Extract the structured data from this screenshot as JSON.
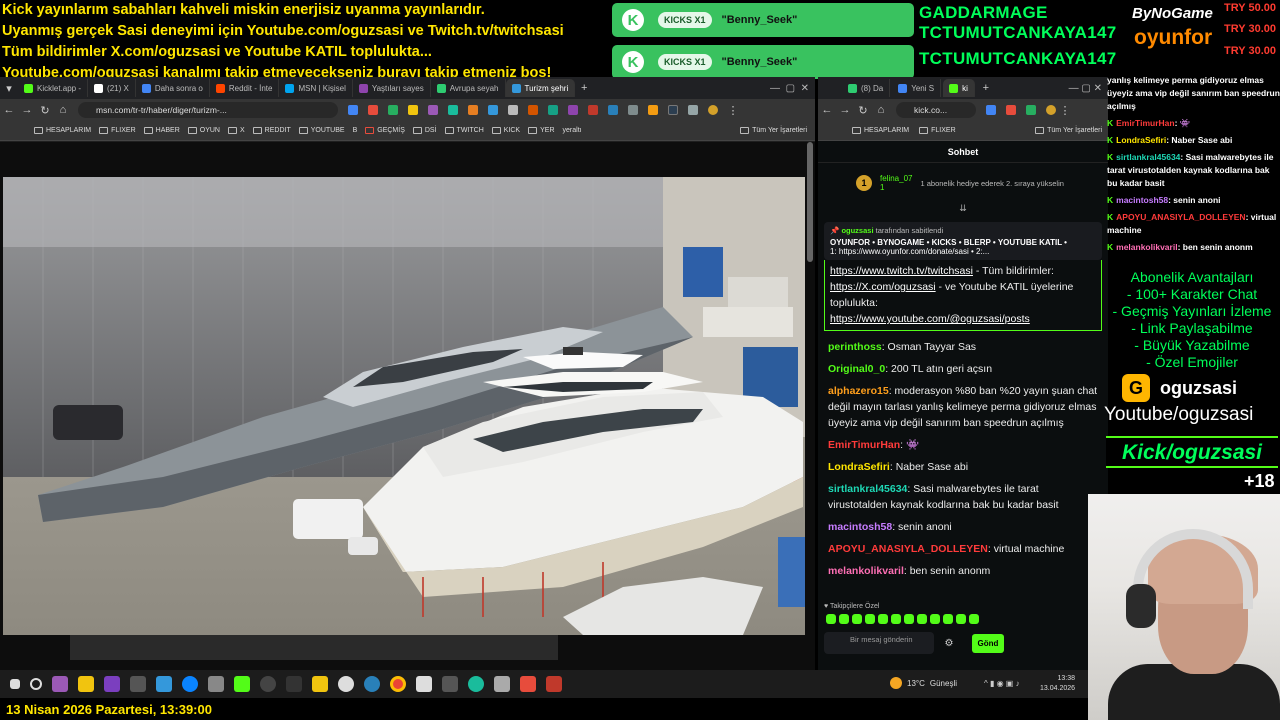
{
  "ticker": [
    "Kick yayınlarım sabahları kahveli miskin enerjisiz uyanma yayınlarıdır.",
    "Uyanmış gerçek Sasi deneyimi için Youtube.com/oguzsasi ve Twitch.tv/twitchsasi",
    "Tüm bildirimler X.com/oguzsasi ve Youtube KATIL toplulukta...",
    "Youtube.com/oguzsasi kanalımı takip etmeyecekseniz burayı takip etmeniz boş!"
  ],
  "notifications": [
    {
      "badge": "KICKS X1",
      "name": "\"Benny_Seek\""
    },
    {
      "badge": "KICKS X1",
      "name": "\"Benny_Seek\""
    }
  ],
  "top_names": [
    "GADDARMAGE",
    "TCTUMUTCANKAYA147",
    "TCTUMUTCANKAYA147"
  ],
  "sponsors": {
    "bynogame": "ByNoGame",
    "oyunfor": "oyunfor"
  },
  "try_values": [
    "TRY 50.00",
    "TRY 30.00",
    "TRY 30.00"
  ],
  "browser1": {
    "tabs": [
      {
        "label": "Kicklet.app -",
        "color": "#53fc18"
      },
      {
        "label": "(21) X",
        "color": "#ffffff"
      },
      {
        "label": "Daha sonra o",
        "color": "#4285f4"
      },
      {
        "label": "Reddit - İnte",
        "color": "#ff4500"
      },
      {
        "label": "MSN | Kişisel",
        "color": "#00a4ef"
      },
      {
        "label": "Yaştıları sayes",
        "color": "#8e44ad"
      },
      {
        "label": "Avrupa seyah",
        "color": "#2ecc71"
      },
      {
        "label": "Turizm şehri",
        "color": "#3498db"
      }
    ],
    "address": "msn.com/tr-tr/haber/diger/turizm-...",
    "bookmarks": [
      "HESAPLARIM",
      "FLIXER",
      "HABER",
      "OYUN",
      "X",
      "REDDIT",
      "YOUTUBE",
      "B",
      "GEÇMİŞ",
      "DSİ",
      "TWITCH",
      "KICK",
      "YER",
      "yeraltı"
    ],
    "bookmarks_right": "Tüm Yer İşaretleri"
  },
  "browser2": {
    "tabs": [
      "(8) Da",
      "Yeni S",
      "ki"
    ],
    "address": "kick.co...",
    "bookmarks": [
      "HESAPLARIM",
      "FLIXER",
      "Tüm Yer İşaretleri"
    ],
    "chat_title": "Sohbet",
    "gift": {
      "rank": "1",
      "name": "felina_07",
      "sub": "1",
      "text": "1 abonelik hediye ederek 2. sıraya yükselin"
    },
    "pinned": {
      "header_user": "oguzsasi",
      "header_suffix": "tarafından sabitlendi",
      "title": "OYUNFOR • BYNOGAME • KICKS • BLERP • YOUTUBE KATIL •",
      "line2": "1: https://www.oyunfor.com/donate/sasi • 2:...",
      "body_link1": "https://www.twitch.tv/twitchsasi",
      "body_text1": " - Tüm bildirimler:",
      "body_link2": "https://X.com/oguzsasi",
      "body_text2": " - ve Youtube KATIL üyelerine toplulukta:",
      "body_link3": "https://www.youtube.com/@oguzsasi/posts"
    },
    "messages": [
      {
        "user": "perinthoss",
        "color": "#53fc18",
        "text": "Osman Tayyar Sas"
      },
      {
        "user": "Original0_0",
        "color": "#53fc18",
        "text": "200 TL atın geri açsın"
      },
      {
        "user": "alphazero15",
        "color": "#ff9f1c",
        "text": "moderasyon %80 ban %20 yayın şuan chat değil mayın tarlası yanlış kelimeye perma gidiyoruz elmas üyeyiz ama vip değil sanırım ban speedrun açılmış"
      },
      {
        "user": "EmirTimurHan",
        "color": "#ff3b3b",
        "text": "👾"
      },
      {
        "user": "LondraSefiri",
        "color": "#ffe600",
        "text": "Naber Sase abi"
      },
      {
        "user": "sirtlankral45634",
        "color": "#1ed8b5",
        "text": "Sasi malwarebytes ile tarat virustotalden kaynak kodlarına bak bu kadar basit"
      },
      {
        "user": "macintosh58",
        "color": "#c77dff",
        "text": "senin anoni"
      },
      {
        "user": "APOYU_ANASIYLA_DOLLEYEN",
        "color": "#ff3b3b",
        "text": "virtual machine"
      },
      {
        "user": "melankolikvaril",
        "color": "#ff6fb5",
        "text": "ben senin anonm"
      }
    ],
    "followers_only": "Takipçilere Özel",
    "input_placeholder": "Bir mesaj gönderin",
    "send_label": "Gönd"
  },
  "overlay_chat": [
    {
      "user": "",
      "text": "yanlış kelimeye perma gidiyoruz elmas üyeyiz ama vip değil sanırım ban speedrun açılmış",
      "color": "#ffffff"
    },
    {
      "user": "EmirTimurHan",
      "text": ": 👾",
      "color": "#ff3b3b"
    },
    {
      "user": "LondraSefiri",
      "text": ": Naber Sase abi",
      "color": "#ffe600"
    },
    {
      "user": "sirtlankral45634",
      "text": ": Sasi malwarebytes ile tarat virustotalden kaynak kodlarına bak bu kadar basit",
      "color": "#1ed8b5"
    },
    {
      "user": "macintosh58",
      "text": ": senin anoni",
      "color": "#c77dff"
    },
    {
      "user": "APOYU_ANASIYLA_DOLLEYEN",
      "text": ": virtual machine",
      "color": "#ff3b3b"
    },
    {
      "user": "melankolikvaril",
      "text": ": ben senin anonm",
      "color": "#ff6fb5"
    }
  ],
  "perks": [
    "Abonelik Avantajları",
    "- 100+ Karakter Chat",
    "- Geçmiş Yayınları İzleme",
    "- Link Paylaşabilme",
    "- Büyük Yazabilme",
    "- Özel Emojiler"
  ],
  "channel": {
    "kick_name": "oguzsasi",
    "youtube": "Youtube/oguzsasi",
    "kick_banner": "Kick/oguzsasi",
    "plus18": "+18"
  },
  "taskbar": {
    "weather_temp": "13°C",
    "weather_text": "Güneşli",
    "time": "13:38",
    "date": "13.04.2026"
  },
  "datetime_overlay": "13 Nisan 2026 Pazartesi, 13:39:00"
}
